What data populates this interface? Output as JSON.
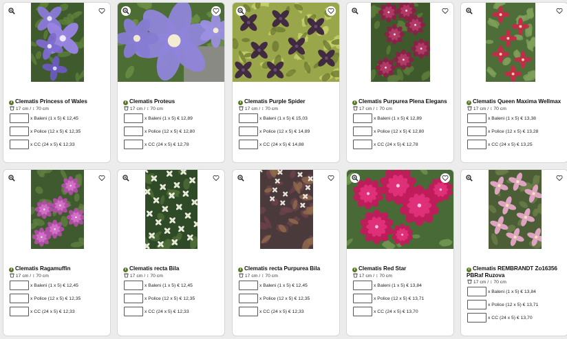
{
  "products": [
    {
      "name": "Clematis Princess of Wales",
      "meta": "17 cm / ↕ 70 cm",
      "options": [
        "x Baleni (1 x 5) € 12,45",
        "x Police (12 x 5) € 12,35",
        "x CC (24 x 5) € 12,33"
      ],
      "image": "purple-star-flowers"
    },
    {
      "name": "Clematis Proteus",
      "meta": "17 cm / ↕ 70 cm",
      "options": [
        "x Baleni (1 x 5) € 12,89",
        "x Police (12 x 5) € 12,80",
        "x CC (24 x 5) € 12,78"
      ],
      "image": "lavender-large-flower"
    },
    {
      "name": "Clematis Purple Spider",
      "meta": "17 cm / ↕ 70 cm",
      "options": [
        "x Baleni (1 x 5) € 15,03",
        "x Police (12 x 5) € 14,89",
        "x CC (24 x 5) € 14,88"
      ],
      "image": "dark-purple-bells"
    },
    {
      "name": "Clematis Purpurea Plena Elegans",
      "meta": "17 cm / ↕ 70 cm",
      "options": [
        "x Baleni (1 x 5) € 12,89",
        "x Police (12 x 5) € 12,80",
        "x CC (24 x 5) € 12,78"
      ],
      "image": "double-maroon-flowers"
    },
    {
      "name": "Clematis Queen Maxima Wellmax",
      "meta": "17 cm / ↕ 70 cm",
      "options": [
        "x Baleni (1 x 5) € 13,38",
        "x Police (12 x 5) € 13,28",
        "x CC (24 x 5) € 13,25"
      ],
      "image": "red-tulip-flowers"
    },
    {
      "name": "Clematis Ragamuffin",
      "meta": "17 cm / ↕ 70 cm",
      "options": [
        "x Baleni (1 x 5) € 12,45",
        "x Police (12 x 5) € 12,35",
        "x CC (24 x 5) € 12,33"
      ],
      "image": "pink-purple-double"
    },
    {
      "name": "Clematis recta Bila",
      "meta": "17 cm / ↕ 70 cm",
      "options": [
        "x Baleni (1 x 5) € 12,45",
        "x Police (12 x 5) € 12,35",
        "x CC (24 x 5) € 12,33"
      ],
      "image": "small-white-flowers"
    },
    {
      "name": "Clematis recta Purpurea Bila",
      "meta": "17 cm / ↕ 70 cm",
      "options": [
        "x Baleni (1 x 5) € 12,45",
        "x Police (12 x 5) € 12,35",
        "x CC (24 x 5) € 12,33"
      ],
      "image": "purple-foliage-white-flowers"
    },
    {
      "name": "Clematis Red  Star",
      "meta": "17 cm / ↕ 70 cm",
      "options": [
        "x Baleni (1 x 5) € 13,84",
        "x Police (12 x 5) € 13,71",
        "x CC (24 x 5) € 13,70"
      ],
      "image": "magenta-double-flowers"
    },
    {
      "name": "Clematis REMBRANDT Zo16356 PBRaf Ruzova",
      "meta": "17 cm / ↕ 70 cm",
      "options": [
        "x Baleni (1 x 5) € 13,84",
        "x Police (12 x 5) € 13,71",
        "x CC (24 x 5) € 13,70"
      ],
      "image": "pink-rose-flowers"
    }
  ]
}
